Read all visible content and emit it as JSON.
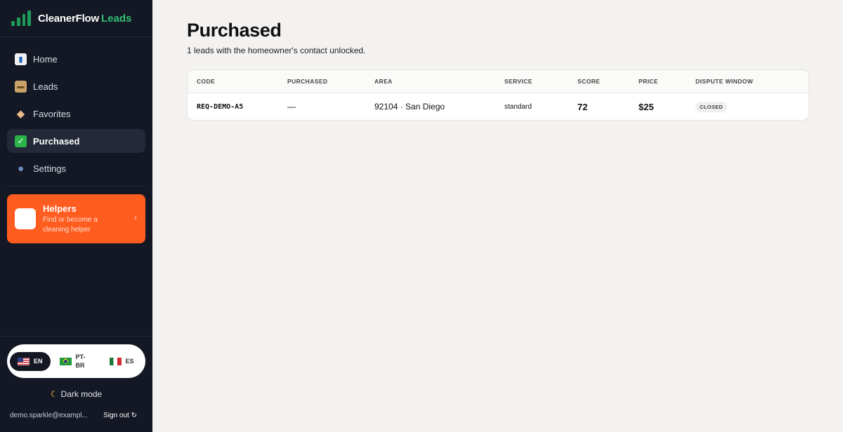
{
  "brand": {
    "name": "CleanerFlow",
    "accent": "Leads",
    "accent_color": "#2fbf73"
  },
  "nav": {
    "items": [
      {
        "label": "Home",
        "icon": "chart-icon"
      },
      {
        "label": "Leads",
        "icon": "box-icon"
      },
      {
        "label": "Favorites",
        "icon": "tag-icon"
      },
      {
        "label": "Purchased",
        "icon": "check-icon",
        "active": true
      },
      {
        "label": "Settings",
        "icon": "person-icon"
      }
    ]
  },
  "helpers": {
    "title": "Helpers",
    "subtitle": "Find or become a cleaning helper",
    "color": "#ff5c20"
  },
  "language": {
    "en": "EN",
    "pt": "PT-BR",
    "es": "ES",
    "selected": "EN"
  },
  "theme": {
    "dark_mode_label": "Dark mode"
  },
  "account": {
    "email": "demo.sparkle@exampl...",
    "sign_out": "Sign out"
  },
  "page": {
    "title": "Purchased",
    "subtitle": "1 leads with the homeowner's contact unlocked."
  },
  "table": {
    "columns": [
      "CODE",
      "PURCHASED",
      "AREA",
      "SERVICE",
      "SCORE",
      "PRICE",
      "DISPUTE WINDOW"
    ],
    "rows": [
      {
        "code": "REQ-DEMO-A5",
        "purchased": "—",
        "area": "92104 · San Diego",
        "service": "standard",
        "score": "72",
        "price": "$25",
        "dispute": "CLOSED"
      }
    ]
  }
}
